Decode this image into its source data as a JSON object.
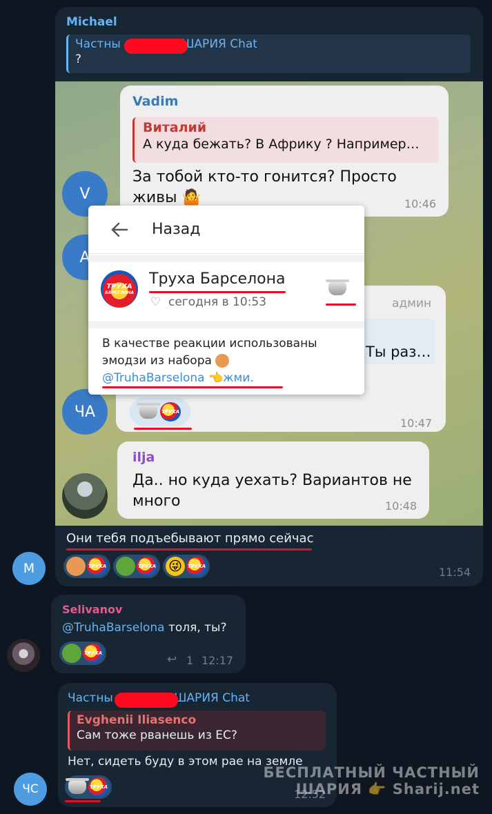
{
  "colors": {
    "bg": "#0e1621",
    "bubble": "#182533",
    "link": "#6ab3f3",
    "accent_red": "#e5102a"
  },
  "messages": {
    "michael": {
      "sender": "Michael",
      "reply_name": "Частны      ШАРИЯ Chat",
      "reply_text": "?"
    },
    "screenshot": {
      "vadim": {
        "sender": "Vadim",
        "quote_name": "Виталий",
        "quote_text": "А куда бежать? В Африку ? Например…",
        "text": "За тобой кто-то гонится? Просто живы 🤷",
        "time": "10:46",
        "avatar": "V"
      },
      "second_avatar": "А",
      "admin_label": "админ",
      "hidden_text": "Ты раз…",
      "cha_avatar": "ЧА",
      "cha_time": "10:47",
      "ilja": {
        "sender": "ilja",
        "text": "Да.. но куда уехать? Вариантов не много",
        "time": "10:48"
      },
      "popup": {
        "back_icon": "arrow-left-icon",
        "back_label": "Назад",
        "channel_name": "Труха Барселона",
        "channel_logo_top": "ТРУХА",
        "channel_logo_bottom": "БАРСЕЛОНА",
        "date_text": "сегодня в 10:53",
        "description_line1": "В качестве реакции использованы",
        "description_line2": "эмодзи из набора",
        "link": "@TruhaBarselona",
        "link_suffix": "жми."
      }
    },
    "m_reply": {
      "text": "Они тебя подъебывают прямо сейчас",
      "time": "11:54",
      "avatar": "M"
    },
    "selivanov": {
      "sender": "Selivanov",
      "mention": "@TruhaBarselona",
      "text": " толя, ты?",
      "reply_count": "1",
      "time": "12:17"
    },
    "last": {
      "sender": "Частны      ШАРИЯ Chat",
      "quote_name": "Evghenii Iliasenco",
      "quote_text": "Сам тоже рванешь из ЕС?",
      "text": "Нет, сидеть буду в этом рае на земле",
      "time": "12:52",
      "avatar": "ЧС"
    }
  },
  "watermark": {
    "line1": "БЕСПЛАТНЫЙ ЧАСТНЫЙ",
    "line2": "ШАРИЯ",
    "line2_suffix": "Sharij.net"
  }
}
